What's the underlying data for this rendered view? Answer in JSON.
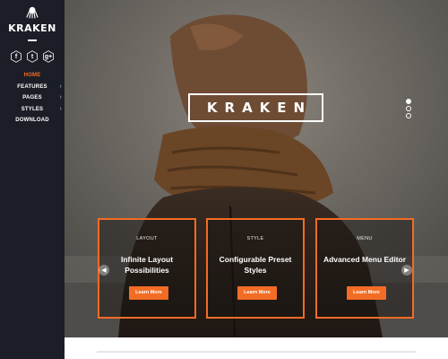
{
  "sidebar": {
    "brand": "KRAKEN",
    "logo_icon": "octopus-icon",
    "socials": [
      {
        "icon": "facebook-icon",
        "glyph": "f"
      },
      {
        "icon": "twitter-icon",
        "glyph": "t"
      },
      {
        "icon": "google-plus-icon",
        "glyph": "g+"
      }
    ],
    "nav": [
      {
        "label": "HOME",
        "active": true
      },
      {
        "label": "FEATURES",
        "has_submenu": true
      },
      {
        "label": "PAGES",
        "has_submenu": true
      },
      {
        "label": "STYLES",
        "has_submenu": true
      },
      {
        "label": "DOWNLOAD"
      }
    ]
  },
  "hero": {
    "title": "KRAKEN",
    "slide_indicators": 3,
    "active_slide": 1,
    "cards": [
      {
        "category": "LAYOUT",
        "title": "Infinite Layout Possibilities",
        "button": "Learn More"
      },
      {
        "category": "STYLE",
        "title": "Configurable Preset Styles",
        "button": "Learn More"
      },
      {
        "category": "MENU",
        "title": "Advanced Menu Editor",
        "button": "Learn More"
      }
    ]
  },
  "colors": {
    "accent": "#f36c25",
    "sidebar_bg": "#1b1e26",
    "text_light": "#ffffff"
  }
}
